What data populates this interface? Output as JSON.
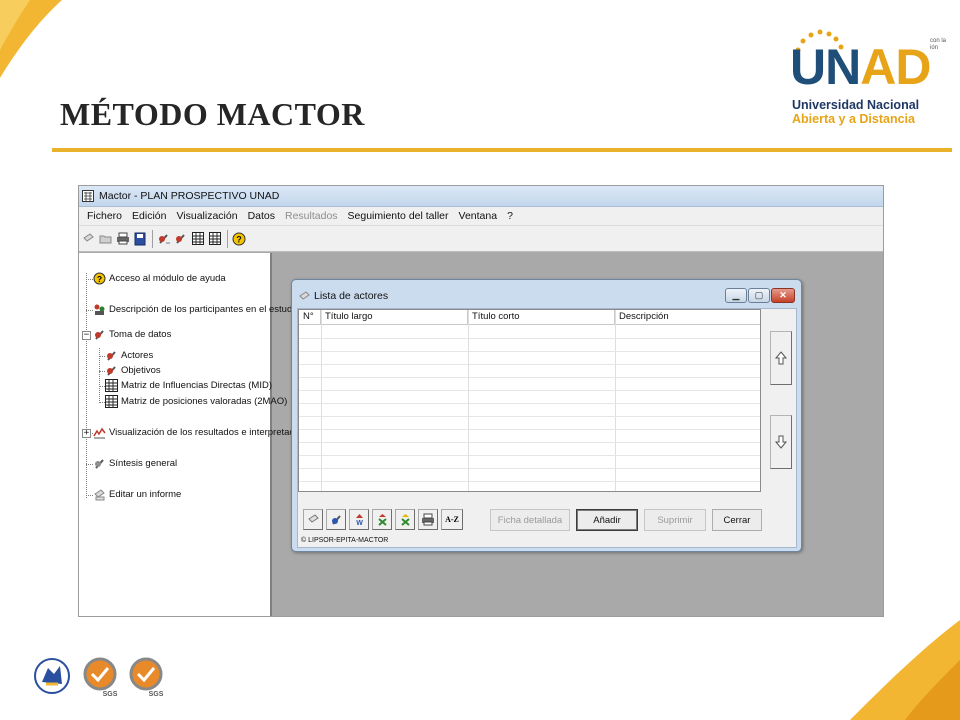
{
  "slide": {
    "title": "MÉTODO MACTOR",
    "logo_big_u": "U",
    "logo_big_n": "N",
    "logo_big_ad": "AD",
    "logo_line1": "Universidad Nacional",
    "logo_line2": "Abierta y a Distancia",
    "corner_note_1": "con la",
    "corner_note_2": "ión",
    "colors": {
      "accent": "#e8b22a",
      "brand_blue": "#1f4e79",
      "brand_orange": "#e8a418"
    }
  },
  "app": {
    "title": "Mactor  -  PLAN PROSPECTIVO UNAD",
    "menu": [
      {
        "label": "Fichero",
        "enabled": true
      },
      {
        "label": "Edición",
        "enabled": true
      },
      {
        "label": "Visualización",
        "enabled": true
      },
      {
        "label": "Datos",
        "enabled": true
      },
      {
        "label": "Resultados",
        "enabled": false
      },
      {
        "label": "Seguimiento del taller",
        "enabled": true
      },
      {
        "label": "Ventana",
        "enabled": true
      },
      {
        "label": "?",
        "enabled": true
      }
    ],
    "tree": {
      "help": "Acceso al módulo de ayuda",
      "participants": "Descripción de los participantes en el estudio",
      "data": "Toma de datos",
      "actors": "Actores",
      "objectives": "Objetivos",
      "mid": "Matriz de Influencias Directas (MID)",
      "mao": "Matriz de posiciones valoradas (2MAO)",
      "results": "Visualización de los resultados e interpretaciones",
      "synthesis": "Síntesis general",
      "report": "Editar un informe"
    }
  },
  "dialog": {
    "title": "Lista de actores",
    "columns": [
      "N°",
      "Título largo",
      "Título corto",
      "Descripción"
    ],
    "buttons": {
      "detail": "Ficha detallada",
      "add": "Añadir",
      "delete": "Suprimir",
      "close": "Cerrar",
      "sort": "A-Z"
    },
    "copyright": "© LIPSOR-EPITA-MACTOR"
  }
}
